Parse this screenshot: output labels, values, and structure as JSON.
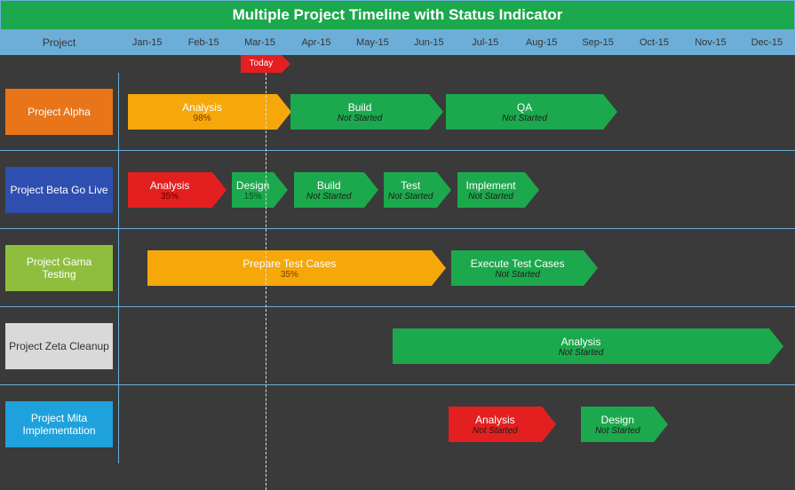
{
  "title": "Multiple Project Timeline with Status Indicator",
  "project_header": "Project",
  "months": [
    "Jan-15",
    "Feb-15",
    "Mar-15",
    "Apr-15",
    "May-15",
    "Jun-15",
    "Jul-15",
    "Aug-15",
    "Sep-15",
    "Oct-15",
    "Nov-15",
    "Dec-15"
  ],
  "today": {
    "label": "Today",
    "month_index": 2.6
  },
  "colors": {
    "amber": "#f6a70a",
    "green": "#1ca84c",
    "red": "#e41f1f",
    "alpha": "#e8751a",
    "beta": "#2e4fb0",
    "gama": "#8fbe3f",
    "zeta": "#d9d9d9",
    "mita": "#1fa2dc"
  },
  "projects": [
    {
      "name": "Project Alpha",
      "color_key": "alpha",
      "tasks": [
        {
          "name": "Analysis",
          "status": "98%",
          "start": 0.15,
          "end": 2.8,
          "color": "amber",
          "kind": "pct"
        },
        {
          "name": "Build",
          "status": "Not Started",
          "start": 3.05,
          "end": 5.5,
          "color": "green",
          "kind": "notstarted"
        },
        {
          "name": "QA",
          "status": "Not Started",
          "start": 5.8,
          "end": 8.6,
          "color": "green",
          "kind": "notstarted"
        }
      ]
    },
    {
      "name": "Project Beta Go Live",
      "color_key": "beta",
      "tasks": [
        {
          "name": "Analysis",
          "status": "35%",
          "start": 0.15,
          "end": 1.65,
          "color": "red",
          "kind": "pct"
        },
        {
          "name": "Design",
          "status": "15%",
          "start": 2.0,
          "end": 2.75,
          "color": "green",
          "kind": "pct"
        },
        {
          "name": "Build",
          "status": "Not Started",
          "start": 3.1,
          "end": 4.35,
          "color": "green",
          "kind": "notstarted"
        },
        {
          "name": "Test",
          "status": "Not Started",
          "start": 4.7,
          "end": 5.65,
          "color": "green",
          "kind": "notstarted"
        },
        {
          "name": "Implement",
          "status": "Not Started",
          "start": 6.0,
          "end": 7.2,
          "color": "green",
          "kind": "notstarted"
        }
      ]
    },
    {
      "name": "Project Gama Testing",
      "color_key": "gama",
      "tasks": [
        {
          "name": "Prepare Test Cases",
          "status": "35%",
          "start": 0.5,
          "end": 5.55,
          "color": "amber",
          "kind": "pct"
        },
        {
          "name": "Execute Test Cases",
          "status": "Not Started",
          "start": 5.9,
          "end": 8.25,
          "color": "green",
          "kind": "notstarted"
        }
      ]
    },
    {
      "name": "Project Zeta Cleanup",
      "color_key": "zeta",
      "label_text_dark": true,
      "tasks": [
        {
          "name": "Analysis",
          "status": "Not Started",
          "start": 4.85,
          "end": 11.55,
          "color": "green",
          "kind": "notstarted"
        }
      ]
    },
    {
      "name": "Project Mita Implementation",
      "color_key": "mita",
      "tasks": [
        {
          "name": "Analysis",
          "status": "Not Started",
          "start": 5.85,
          "end": 7.5,
          "color": "red",
          "kind": "notstarted"
        },
        {
          "name": "Design",
          "status": "Not Started",
          "start": 8.2,
          "end": 9.5,
          "color": "green",
          "kind": "notstarted"
        }
      ]
    }
  ],
  "chart_data": {
    "type": "gantt",
    "title": "Multiple Project Timeline with Status Indicator",
    "x_categories": [
      "Jan-15",
      "Feb-15",
      "Mar-15",
      "Apr-15",
      "May-15",
      "Jun-15",
      "Jul-15",
      "Aug-15",
      "Sep-15",
      "Oct-15",
      "Nov-15",
      "Dec-15"
    ],
    "today": "mid Mar-15",
    "series": [
      {
        "project": "Project Alpha",
        "task": "Analysis",
        "start": "Jan-15",
        "end": "Mar-15",
        "status": "98%",
        "status_color": "amber"
      },
      {
        "project": "Project Alpha",
        "task": "Build",
        "start": "Apr-15",
        "end": "Jun-15",
        "status": "Not Started",
        "status_color": "green"
      },
      {
        "project": "Project Alpha",
        "task": "QA",
        "start": "Jun-15",
        "end": "Sep-15",
        "status": "Not Started",
        "status_color": "green"
      },
      {
        "project": "Project Beta Go Live",
        "task": "Analysis",
        "start": "Jan-15",
        "end": "Feb-15",
        "status": "35%",
        "status_color": "red"
      },
      {
        "project": "Project Beta Go Live",
        "task": "Design",
        "start": "Mar-15",
        "end": "Mar-15",
        "status": "15%",
        "status_color": "green"
      },
      {
        "project": "Project Beta Go Live",
        "task": "Build",
        "start": "Apr-15",
        "end": "May-15",
        "status": "Not Started",
        "status_color": "green"
      },
      {
        "project": "Project Beta Go Live",
        "task": "Test",
        "start": "May-15",
        "end": "Jun-15",
        "status": "Not Started",
        "status_color": "green"
      },
      {
        "project": "Project Beta Go Live",
        "task": "Implement",
        "start": "Jul-15",
        "end": "Aug-15",
        "status": "Not Started",
        "status_color": "green"
      },
      {
        "project": "Project Gama Testing",
        "task": "Prepare Test Cases",
        "start": "Jan-15",
        "end": "Jun-15",
        "status": "35%",
        "status_color": "amber"
      },
      {
        "project": "Project Gama Testing",
        "task": "Execute Test Cases",
        "start": "Jun-15",
        "end": "Sep-15",
        "status": "Not Started",
        "status_color": "green"
      },
      {
        "project": "Project Zeta Cleanup",
        "task": "Analysis",
        "start": "May-15",
        "end": "Dec-15",
        "status": "Not Started",
        "status_color": "green"
      },
      {
        "project": "Project Mita Implementation",
        "task": "Analysis",
        "start": "Jun-15",
        "end": "Aug-15",
        "status": "Not Started",
        "status_color": "red"
      },
      {
        "project": "Project Mita Implementation",
        "task": "Design",
        "start": "Sep-15",
        "end": "Oct-15",
        "status": "Not Started",
        "status_color": "green"
      }
    ]
  }
}
